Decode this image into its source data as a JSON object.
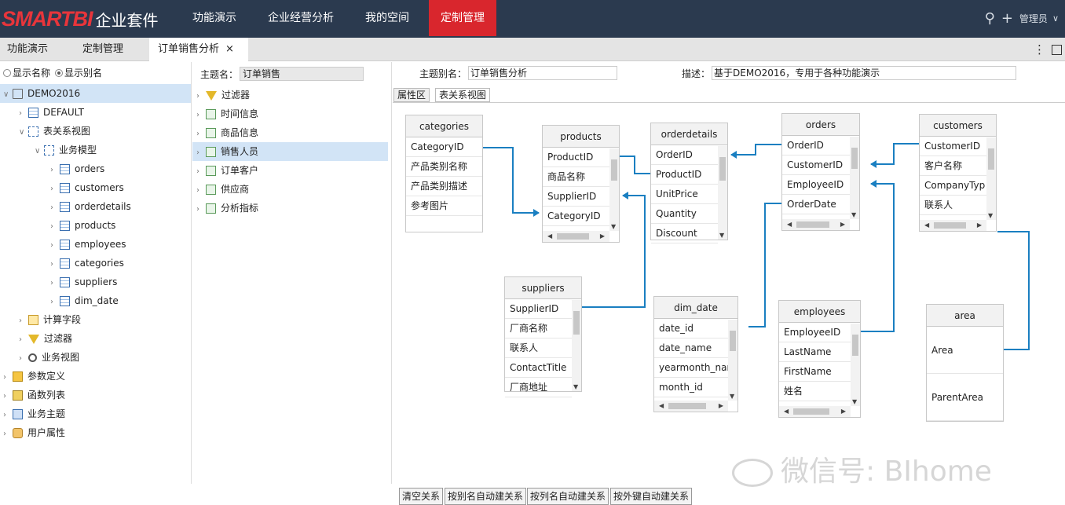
{
  "app": {
    "brand": "SMARTBI",
    "suite": "企业套件"
  },
  "topnav": [
    {
      "label": "功能演示"
    },
    {
      "label": "企业经营分析"
    },
    {
      "label": "我的空间"
    },
    {
      "label": "定制管理",
      "active": true
    }
  ],
  "user": {
    "label": "管理员"
  },
  "tabs": [
    {
      "label": "功能演示"
    },
    {
      "label": "定制管理"
    },
    {
      "label": "订单销售分析",
      "active": true,
      "close": "×"
    }
  ],
  "left_panel": {
    "radio_names": "显示名称",
    "radio_alias": "显示别名",
    "tree": [
      {
        "label": "DEMO2016",
        "icon": "database-icon"
      },
      {
        "label": "DEFAULT",
        "icon": "schema-icon"
      },
      {
        "label": "表关系视图",
        "icon": "relation-view-icon"
      },
      {
        "label": "业务模型",
        "icon": "model-icon"
      },
      {
        "label": "orders",
        "icon": "table-icon"
      },
      {
        "label": "customers",
        "icon": "table-icon"
      },
      {
        "label": "orderdetails",
        "icon": "table-icon"
      },
      {
        "label": "products",
        "icon": "table-icon"
      },
      {
        "label": "employees",
        "icon": "table-icon"
      },
      {
        "label": "categories",
        "icon": "table-icon"
      },
      {
        "label": "suppliers",
        "icon": "table-icon"
      },
      {
        "label": "dim_date",
        "icon": "table-icon"
      },
      {
        "label": "计算字段",
        "icon": "calc-field-icon"
      },
      {
        "label": "过滤器",
        "icon": "filter-icon"
      },
      {
        "label": "业务视图",
        "icon": "search-icon"
      },
      {
        "label": "参数定义",
        "icon": "param-icon"
      },
      {
        "label": "函数列表",
        "icon": "function-icon"
      },
      {
        "label": "业务主题",
        "icon": "subject-icon"
      },
      {
        "label": "用户属性",
        "icon": "user-attr-icon"
      }
    ]
  },
  "mid_panel": {
    "subject_name_label": "主题名：",
    "subject_name_value": "订单销售",
    "tree": [
      {
        "label": "过滤器",
        "icon": "filter-icon"
      },
      {
        "label": "时间信息",
        "icon": "folder-icon"
      },
      {
        "label": "商品信息",
        "icon": "folder-icon"
      },
      {
        "label": "销售人员",
        "icon": "folder-icon"
      },
      {
        "label": "订单客户",
        "icon": "folder-icon"
      },
      {
        "label": "供应商",
        "icon": "folder-icon"
      },
      {
        "label": "分析指标",
        "icon": "folder-icon"
      }
    ]
  },
  "right_panel": {
    "alias_label": "主题别名：",
    "alias_value": "订单销售分析",
    "desc_label": "描述：",
    "desc_value": "基于DEMO2016，专用于各种功能演示",
    "subtabs": [
      {
        "label": "属性区"
      },
      {
        "label": "表关系视图",
        "active": true
      }
    ],
    "entities": [
      {
        "title": "categories",
        "rows": [
          "CategoryID",
          "产品类别名称",
          "产品类别描述",
          "参考图片"
        ]
      },
      {
        "title": "products",
        "rows": [
          "ProductID",
          "商品名称",
          "SupplierID",
          "CategoryID"
        ]
      },
      {
        "title": "orderdetails",
        "rows": [
          "OrderID",
          "ProductID",
          "UnitPrice",
          "Quantity",
          "Discount"
        ]
      },
      {
        "title": "orders",
        "rows": [
          "OrderID",
          "CustomerID",
          "EmployeeID",
          "OrderDate"
        ]
      },
      {
        "title": "customers",
        "rows": [
          "CustomerID",
          "客户名称",
          "CompanyTyp",
          "联系人"
        ]
      },
      {
        "title": "suppliers",
        "rows": [
          "SupplierID",
          "厂商名称",
          "联系人",
          "ContactTitle",
          "厂商地址"
        ]
      },
      {
        "title": "dim_date",
        "rows": [
          "date_id",
          "date_name",
          "yearmonth_nar",
          "month_id"
        ]
      },
      {
        "title": "employees",
        "rows": [
          "EmployeeID",
          "LastName",
          "FirstName",
          "姓名"
        ]
      },
      {
        "title": "area",
        "rows": [
          "Area",
          "ParentArea"
        ]
      }
    ],
    "buttons": [
      {
        "label": "清空关系"
      },
      {
        "label": "按别名自动建关系"
      },
      {
        "label": "按列名自动建关系"
      },
      {
        "label": "按外键自动建关系"
      }
    ],
    "watermark": "微信号: BIhome"
  },
  "colors": {
    "topbar": "#2b3a4f",
    "accent": "#d9262d",
    "link": "#1a7fc1",
    "selection": "#d2e4f6"
  }
}
